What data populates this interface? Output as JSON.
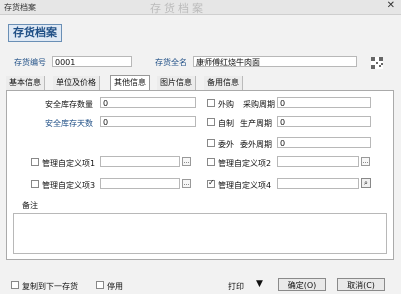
{
  "window": {
    "title": "存货档案",
    "blurred_title": "存货档案"
  },
  "heading": "存货档案",
  "header_fields": {
    "code_label": "存货编号",
    "code_value": "0001",
    "name_label": "存货全名",
    "name_value": "康师傅红烧牛肉面"
  },
  "tabs": [
    {
      "label": "基本信息",
      "active": false
    },
    {
      "label": "单位及价格",
      "active": false
    },
    {
      "label": "其他信息",
      "active": true
    },
    {
      "label": "图片信息",
      "active": false
    },
    {
      "label": "备用信息",
      "active": false
    }
  ],
  "other_info": {
    "safety_stock_label": "安全库存数量",
    "safety_stock_value": "0",
    "safety_days_label": "安全库存天数",
    "safety_days_value": "0",
    "outsource_buy": {
      "label": "外购",
      "checked": false,
      "period_label": "采购周期",
      "period_value": "0"
    },
    "self_made": {
      "label": "自制",
      "checked": false,
      "period_label": "生产周期",
      "period_value": "0"
    },
    "outsourced": {
      "label": "委外",
      "checked": false,
      "period_label": "委外周期",
      "period_value": "0"
    },
    "custom1": {
      "label": "管理自定义项1",
      "checked": false,
      "value": ""
    },
    "custom2": {
      "label": "管理自定义项2",
      "checked": false,
      "value": ""
    },
    "custom3": {
      "label": "管理自定义项3",
      "checked": false,
      "value": ""
    },
    "custom4": {
      "label": "管理自定义项4",
      "checked": true,
      "value": ""
    },
    "remark_label": "备注",
    "remark_value": ""
  },
  "footer": {
    "copy_next": {
      "label": "复制到下一存货",
      "checked": false
    },
    "disabled": {
      "label": "停用",
      "checked": false
    },
    "print_label": "打印",
    "ok_label": "确定(O)",
    "cancel_label": "取消(C)"
  }
}
